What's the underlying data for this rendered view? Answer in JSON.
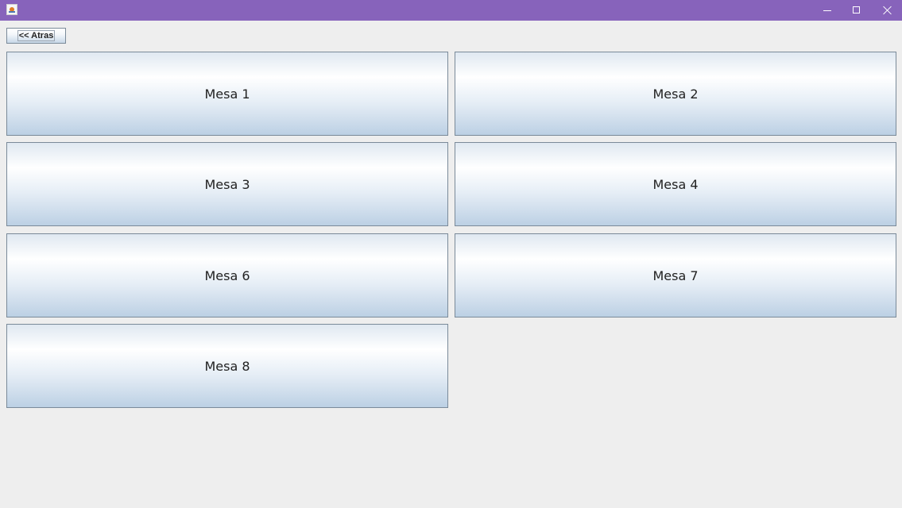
{
  "window": {
    "app_icon": "java-app-icon",
    "titlebar_color": "#8763bb",
    "controls": {
      "minimize": "minimize-icon",
      "maximize": "maximize-icon",
      "close": "close-icon"
    }
  },
  "toolbar": {
    "back_label": "<< Atras"
  },
  "mesas": [
    {
      "label": "Mesa 1"
    },
    {
      "label": "Mesa 2"
    },
    {
      "label": "Mesa 3"
    },
    {
      "label": "Mesa 4"
    },
    {
      "label": "Mesa 6"
    },
    {
      "label": "Mesa 7"
    },
    {
      "label": "Mesa 8"
    }
  ]
}
